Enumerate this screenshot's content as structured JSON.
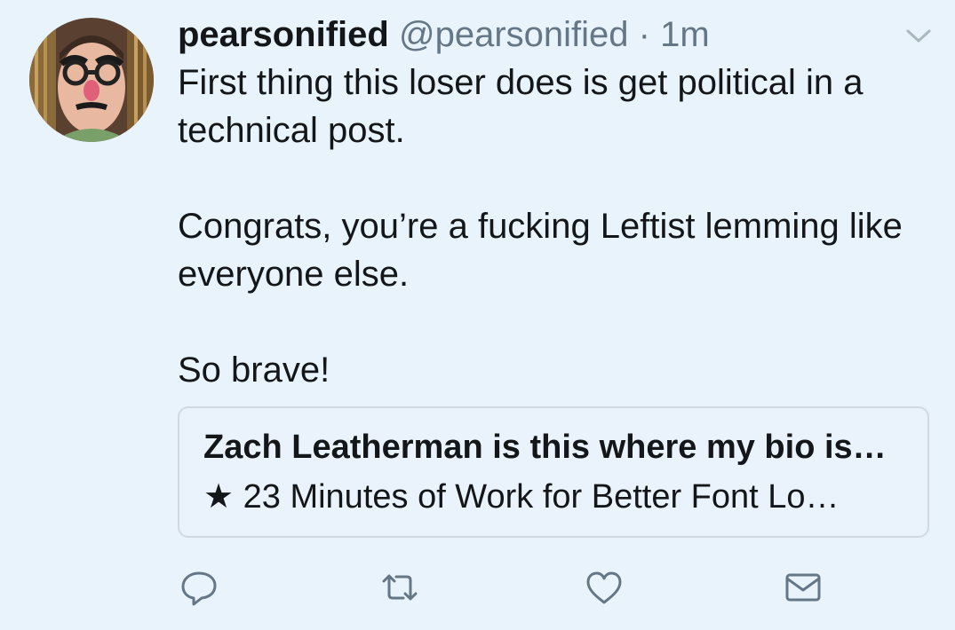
{
  "tweet": {
    "display_name": "pearsonified",
    "handle": "@pearsonified",
    "separator": "·",
    "timestamp": "1m",
    "body": [
      "First thing this loser does is get political in a technical post.",
      "Congrats, you’re a fucking Leftist lemming like everyone else.",
      "So brave!"
    ],
    "quoted": {
      "author": "Zach Leatherman is this where my bio is…",
      "text": "★ 23 Minutes of Work for Better Font Lo…"
    }
  },
  "icons": {
    "menu": "chevron-down-icon",
    "reply": "reply-icon",
    "retweet": "retweet-icon",
    "like": "heart-icon",
    "dm": "envelope-icon"
  },
  "colors": {
    "background": "#e9f3fb",
    "text": "#14171a",
    "secondary": "#657786",
    "card_border": "#cfd9e2"
  }
}
